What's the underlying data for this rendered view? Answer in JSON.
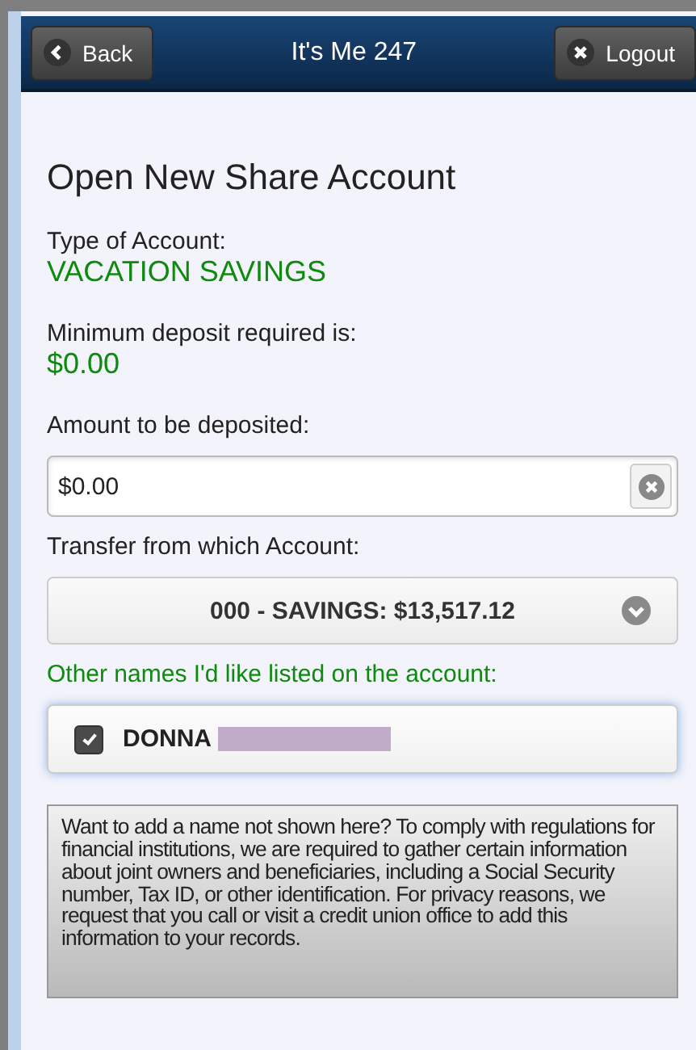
{
  "header": {
    "title": "It's Me 247",
    "back": "Back",
    "logout": "Logout"
  },
  "page_title": "Open New Share Account",
  "account_type": {
    "label": "Type of Account:",
    "value": "VACATION SAVINGS"
  },
  "minimum_deposit": {
    "label": "Minimum deposit required is:",
    "value": "$0.00"
  },
  "amount": {
    "label": "Amount to be deposited:",
    "value": "$0.00"
  },
  "transfer": {
    "label": "Transfer from which Account:",
    "value": "000 - SAVINGS: $13,517.12"
  },
  "other_names": {
    "label": "Other names I'd like listed on the account:",
    "items": [
      {
        "name": "DONNA",
        "checked": true,
        "redacted": true
      }
    ]
  },
  "notice": "Want to add a name not shown here? To comply with regulations for financial institutions, we are required to gather certain information about joint owners and beneficiaries, including a Social Security number, Tax ID, or other identification. For privacy reasons, we request that you call or visit a credit union office to add this information to your records."
}
